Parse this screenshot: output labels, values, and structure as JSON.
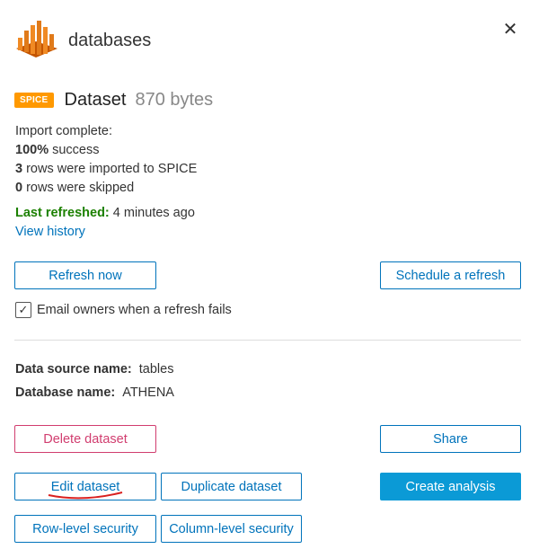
{
  "header": {
    "title": "databases",
    "icon": "bar-chart-icon",
    "close_glyph": "✕"
  },
  "dataset": {
    "badge": "SPICE",
    "name": "Dataset",
    "size": "870 bytes"
  },
  "status": {
    "line1": "Import complete:",
    "success_value": "100%",
    "success_text": " success",
    "imported_value": "3",
    "imported_text": " rows were imported to SPICE",
    "skipped_value": "0",
    "skipped_text": " rows were skipped"
  },
  "refresh": {
    "last_label": "Last refreshed:",
    "last_value": " 4 minutes ago",
    "history_link": "View history",
    "refresh_now": "Refresh now",
    "schedule": "Schedule a refresh",
    "email_label": "Email owners when a refresh fails",
    "email_checked": true
  },
  "details": {
    "source_label": "Data source name:",
    "source_value": "tables",
    "db_label": "Database name:",
    "db_value": "ATHENA"
  },
  "actions": {
    "delete": "Delete dataset",
    "share": "Share",
    "edit": "Edit dataset",
    "duplicate": "Duplicate dataset",
    "create_analysis": "Create analysis",
    "row_security": "Row-level security",
    "column_security": "Column-level security"
  },
  "colors": {
    "accent": "#0073bb",
    "spice": "#ff9900",
    "danger": "#d13d6f",
    "success": "#1d8102",
    "primary": "#0b9ad6"
  }
}
